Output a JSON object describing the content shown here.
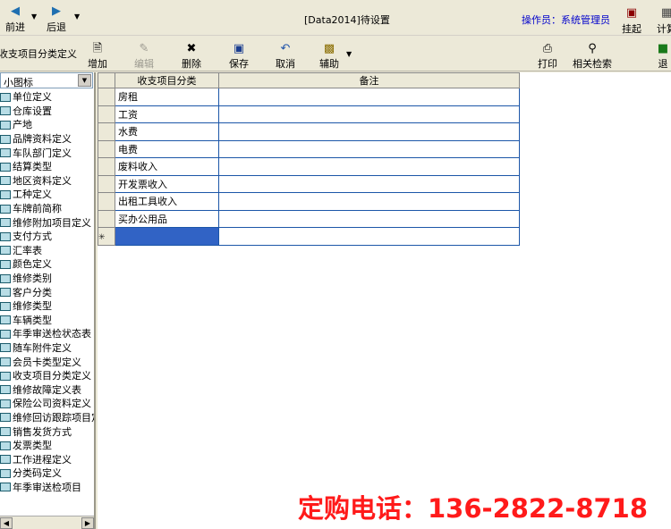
{
  "nav": {
    "forward_label": "前进",
    "back_label": "后退",
    "title": "[Data2014]待设置",
    "operator": "操作员：系统管理员",
    "suspend_label": "挂起",
    "calc_label": "计算"
  },
  "toolbar": {
    "module_title": "收支项目分类定义",
    "add_label": "增加",
    "edit_label": "编辑",
    "delete_label": "删除",
    "save_label": "保存",
    "cancel_label": "取消",
    "assist_label": "辅助",
    "print_label": "打印",
    "search_label": "相关检索",
    "exit_label": "退"
  },
  "sidebar": {
    "view_mode": "小图标",
    "items": [
      "单位定义",
      "仓库设置",
      "产地",
      "品牌资料定义",
      "车队部门定义",
      "结算类型",
      "地区资料定义",
      "工种定义",
      "车牌前简称",
      "维修附加项目定义",
      "支付方式",
      "汇率表",
      "颜色定义",
      "维修类别",
      "客户分类",
      "维修类型",
      "车辆类型",
      "年季审送检状态表",
      "随车附件定义",
      "会员卡类型定义",
      "收支项目分类定义",
      "维修故障定义表",
      "保险公司资料定义",
      "维修回访跟踪项目定义",
      "销售发货方式",
      "发票类型",
      "工作进程定义",
      "分类码定义",
      "年季审送检项目"
    ]
  },
  "grid": {
    "columns": [
      "收支项目分类",
      "备注"
    ],
    "rows": [
      {
        "name": "房租",
        "remark": ""
      },
      {
        "name": "工资",
        "remark": ""
      },
      {
        "name": "水费",
        "remark": ""
      },
      {
        "name": "电费",
        "remark": ""
      },
      {
        "name": "废料收入",
        "remark": ""
      },
      {
        "name": "开发票收入",
        "remark": ""
      },
      {
        "name": "出租工具收入",
        "remark": ""
      },
      {
        "name": "买办公用品",
        "remark": ""
      },
      {
        "name": "",
        "remark": ""
      }
    ]
  },
  "banner": "定购电话：136-2822-8718"
}
